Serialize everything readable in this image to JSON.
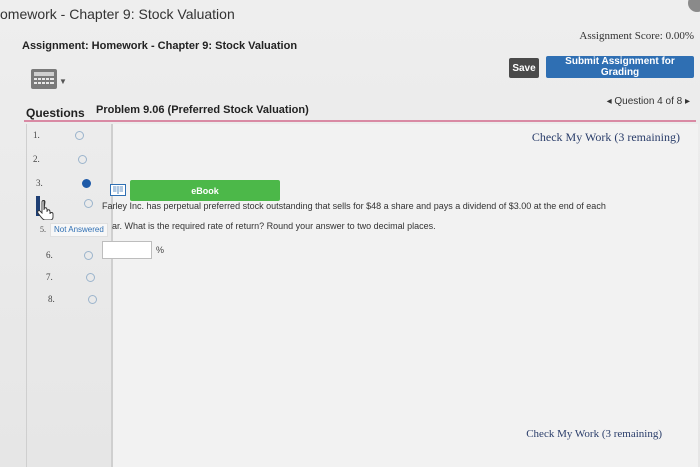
{
  "window": {
    "title": "omework - Chapter 9: Stock Valuation"
  },
  "assignment": {
    "title": "Assignment: Homework - Chapter 9: Stock Valuation",
    "score": "Assignment Score: 0.00%"
  },
  "toolbar": {
    "save_label": "Save",
    "submit_label": "Submit Assignment for Grading",
    "calculator_icon": "calculator-icon"
  },
  "questions_panel": {
    "header": "Questions",
    "items": [
      {
        "number": "1.",
        "status": "unanswered"
      },
      {
        "number": "2.",
        "status": "unanswered"
      },
      {
        "number": "3.",
        "status": "answered"
      },
      {
        "number": "4.",
        "status": "unanswered"
      },
      {
        "number": "5.",
        "status": "not-answered",
        "badge": "Not Answered"
      },
      {
        "number": "6.",
        "status": "unanswered"
      },
      {
        "number": "7.",
        "status": "unanswered"
      },
      {
        "number": "8.",
        "status": "unanswered"
      }
    ]
  },
  "problem": {
    "title": "Problem 9.06 (Preferred Stock Valuation)",
    "nav": "◂ Question 4 of 8 ▸",
    "check_my_work_top": "Check My Work (3 remaining)",
    "check_my_work_bottom": "Check My Work (3 remaining)",
    "ebook_label": "eBook",
    "text_line_1": "Farley Inc. has perpetual preferred stock outstanding that sells for $48 a share and pays a dividend of $3.00 at the end of each",
    "text_line_2": "ar. What is the required rate of return? Round your answer to two decimal places.",
    "answer_value": "",
    "answer_unit": "%"
  },
  "colors": {
    "submit_blue": "#2f6fb3",
    "ebook_green": "#4cb849",
    "answered_dot": "#1e5aa8",
    "rule_pink": "#d98aa4"
  }
}
